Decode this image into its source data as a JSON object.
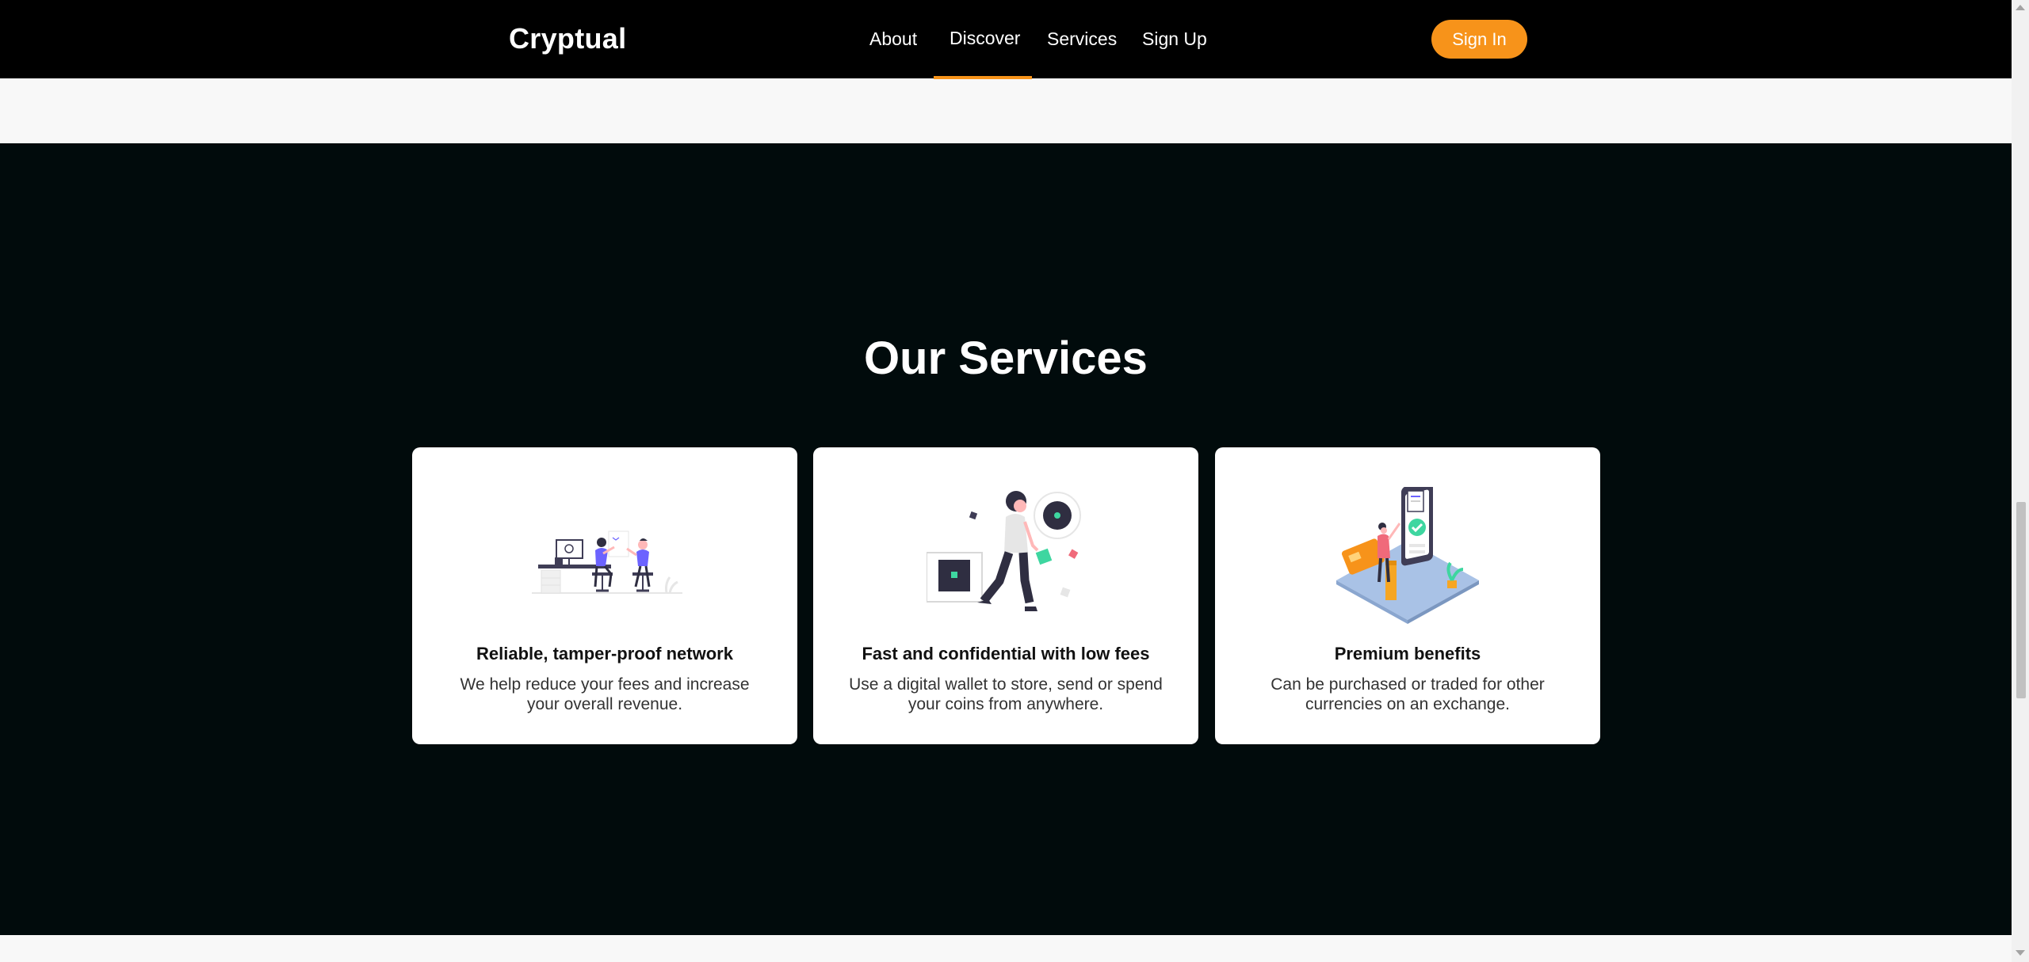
{
  "navbar": {
    "brand": "Cryptual",
    "links": [
      {
        "label": "About"
      },
      {
        "label": "Discover",
        "active": true
      },
      {
        "label": "Services"
      },
      {
        "label": "Sign Up"
      }
    ],
    "signin_label": "Sign In"
  },
  "services": {
    "heading": "Our Services",
    "cards": [
      {
        "title": "Reliable, tamper-proof network",
        "description": "We help reduce your fees and increase your overall revenue.",
        "illustration": "people-working-illustration"
      },
      {
        "title": "Fast and confidential with low fees",
        "description": "Use a digital wallet to store, send or spend your coins from anywhere.",
        "illustration": "woman-walking-illustration"
      },
      {
        "title": "Premium benefits",
        "description": "Can be purchased or traded for other currencies on an exchange.",
        "illustration": "phone-payment-illustration"
      }
    ]
  },
  "colors": {
    "accent": "#f7931a",
    "nav_background": "#000000",
    "section_background": "#010b0c",
    "page_background": "#f8f8f8",
    "card_background": "#ffffff"
  }
}
